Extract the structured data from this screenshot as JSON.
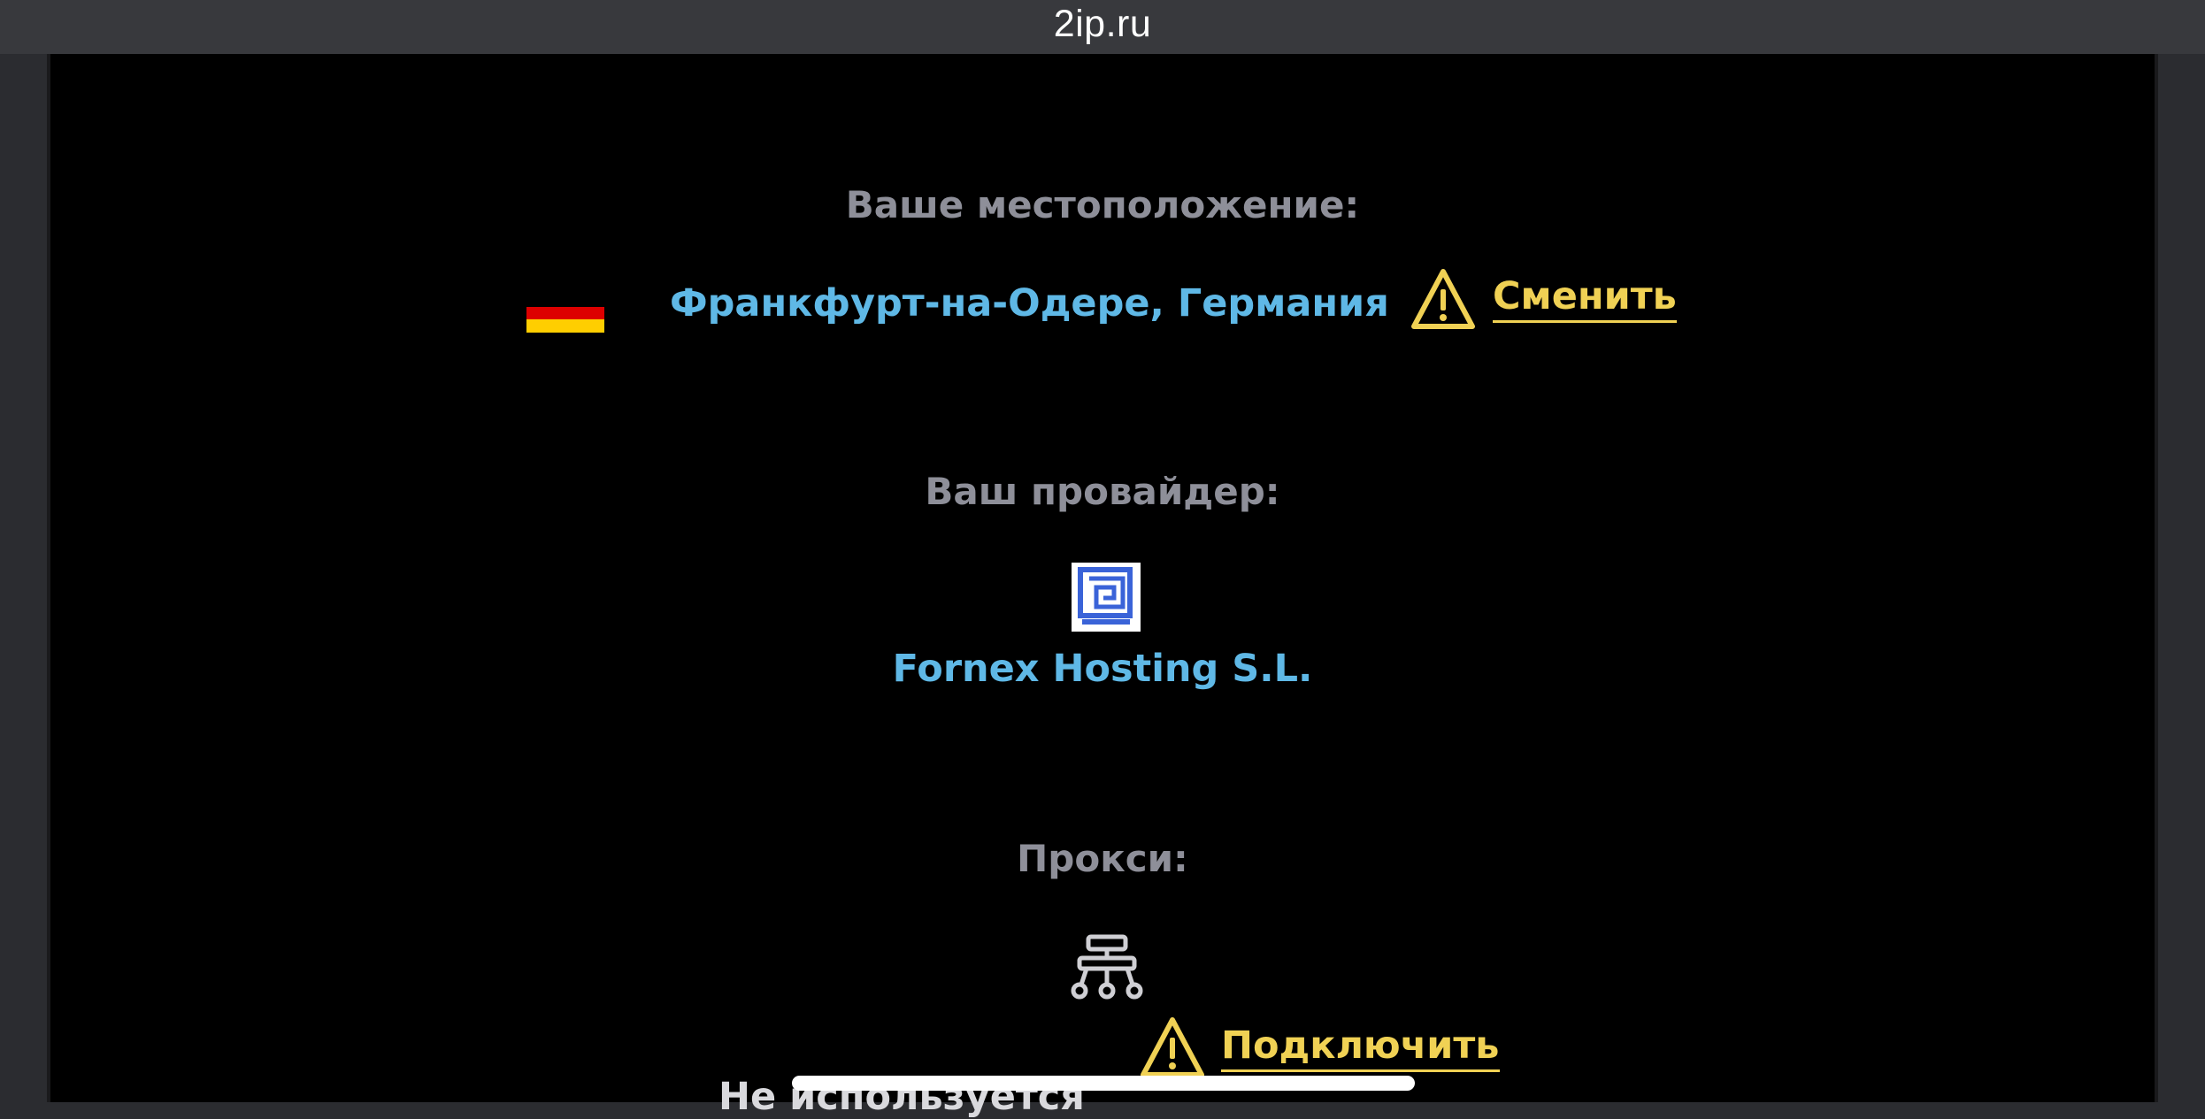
{
  "browser": {
    "url": "2ip.ru"
  },
  "location": {
    "label": "Ваше местоположение:",
    "value": "Франкфурт-на-Одере, Германия",
    "action": "Сменить",
    "flag_colors": [
      "#000000",
      "#dd0000",
      "#ffce00"
    ],
    "icon": "warning-icon"
  },
  "provider": {
    "label": "Ваш провайдер:",
    "value": "Fornex Hosting S.L.",
    "icon": "provider-logo"
  },
  "proxy": {
    "label": "Прокси:",
    "value": "Не используется",
    "action": "Подключить",
    "icon": "network-hierarchy-icon"
  },
  "colors": {
    "accent_blue": "#5fb8e6",
    "accent_yellow": "#f0d154",
    "label_gray": "#8e8f99"
  }
}
